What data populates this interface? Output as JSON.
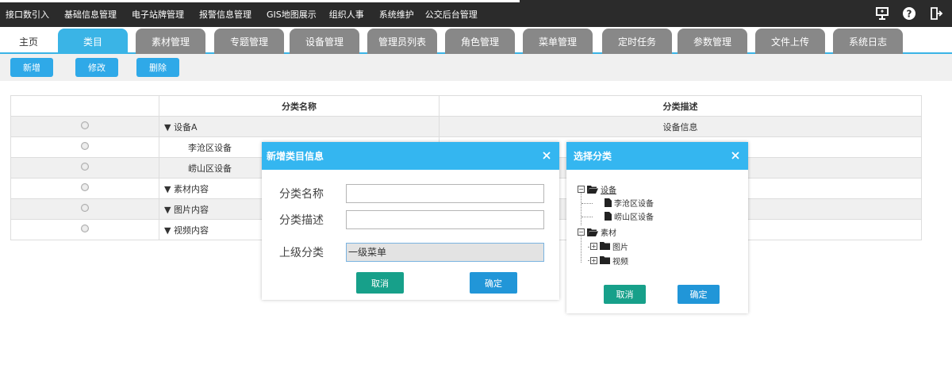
{
  "topmenu": [
    "接口数引入",
    "基础信息管理",
    "电子站牌管理",
    "报警信息管理",
    "GIS地图展示",
    "组织人事",
    "系统维护",
    "公交后台管理"
  ],
  "topicons": [
    "monitor-icon",
    "help-icon",
    "logout-icon"
  ],
  "tabs": {
    "home": "主页",
    "items": [
      "类目",
      "素材管理",
      "专题管理",
      "设备管理",
      "管理员列表",
      "角色管理",
      "菜单管理",
      "定时任务",
      "参数管理",
      "文件上传",
      "系统日志"
    ]
  },
  "toolbar": {
    "add": "新增",
    "edit": "修改",
    "delete": "删除"
  },
  "table": {
    "headers": {
      "name": "分类名称",
      "desc": "分类描述"
    },
    "rows": [
      {
        "name": "▼ 设备A",
        "desc": "设备信息"
      },
      {
        "name": "李沧区设备",
        "desc": ""
      },
      {
        "name": "崂山区设备",
        "desc": ""
      },
      {
        "name": "▼ 素材内容",
        "desc": ""
      },
      {
        "name": "▼ 图片内容",
        "desc": ""
      },
      {
        "name": "▼ 视频内容",
        "desc": ""
      }
    ]
  },
  "dialog_add": {
    "title": "新增类目信息",
    "fields": {
      "name_label": "分类名称",
      "desc_label": "分类描述",
      "parent_label": "上级分类",
      "parent_value": "一级菜单"
    },
    "cancel": "取消",
    "confirm": "确定"
  },
  "dialog_select": {
    "title": "选择分类",
    "tree": {
      "root1": "设备",
      "child1": "李沧区设备",
      "child2": "崂山区设备",
      "root2": "素材",
      "sub1": "图片",
      "sub2": "视频"
    },
    "cancel": "取消",
    "confirm": "确定"
  },
  "colors": {
    "accent": "#3ab4e6",
    "topbar": "#2b2b2b",
    "tab_inactive": "#888888",
    "teal_button": "#17a08a",
    "blue_button": "#2196d8"
  }
}
